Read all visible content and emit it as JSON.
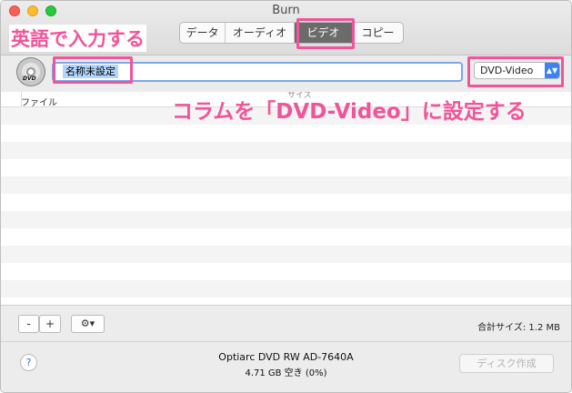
{
  "window": {
    "title": "Burn"
  },
  "tabs": [
    {
      "label": "データ"
    },
    {
      "label": "オーディオ"
    },
    {
      "label": "ビデオ"
    },
    {
      "label": "コピー"
    }
  ],
  "disc_name_input": {
    "value": "名称未設定"
  },
  "disc_icon": {
    "label": "DVD",
    "icon": "dvd-disc-icon"
  },
  "format_select": {
    "value": "DVD-Video",
    "icon": "up-down-chevron-icon"
  },
  "file_list": {
    "columns": [
      {
        "label": "ファイル"
      },
      {
        "label": "サイズ"
      }
    ],
    "rows": []
  },
  "bottom_bar": {
    "remove_label": "-",
    "add_label": "+",
    "action_label": "⚙▾",
    "total_size": "合計サイズ: 1.2 MB"
  },
  "status": {
    "help_label": "?",
    "drive_name": "Optiarc DVD RW AD-7640A",
    "drive_space": "4.71 GB 空き (0%)",
    "burn_label": "ディスク作成"
  },
  "annotations": {
    "top_note": "英語で入力する",
    "side_note": "コラムを「DVD-Video」に設定する"
  },
  "colors": {
    "annotation": "#f0549a",
    "selected_tab": "#6b6b6b",
    "focus_ring": "#7aa9e6",
    "selection_highlight": "#b3d4fd",
    "select_arrow": "#3a83f1"
  }
}
